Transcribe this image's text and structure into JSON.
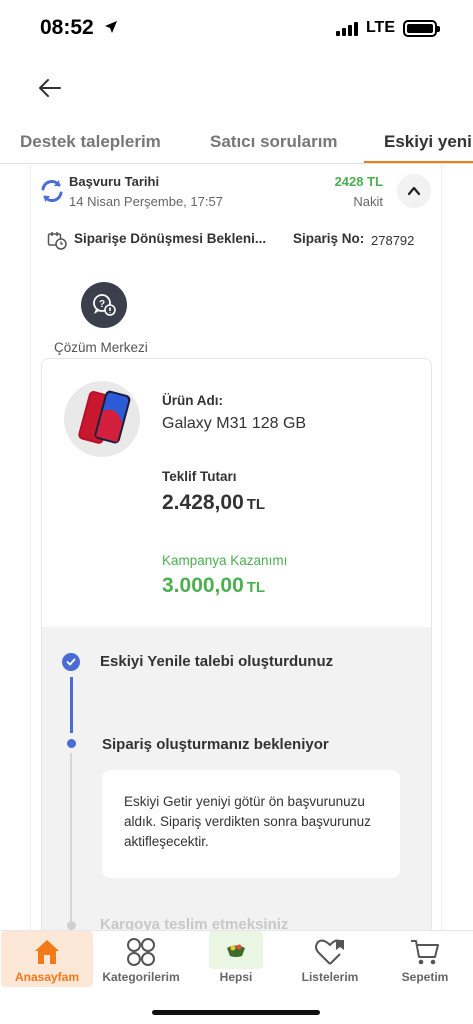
{
  "status_bar": {
    "time": "08:52",
    "network": "LTE"
  },
  "tabs": [
    {
      "label": "Destek taleplerim",
      "active": false
    },
    {
      "label": "Satıcı sorularım",
      "active": false
    },
    {
      "label": "Eskiyi yenil",
      "active": true
    }
  ],
  "application": {
    "date_label": "Başvuru Tarihi",
    "date_value": "14 Nisan Perşembe, 17:57",
    "amount": "2428 TL",
    "payment_type": "Nakit",
    "order_status": "Siparişe Dönüşmesi Bekleni...",
    "order_no_label": "Sipariş No:",
    "order_no": "278792"
  },
  "solution_center": {
    "label": "Çözüm Merkezi"
  },
  "product": {
    "name_label": "Ürün Adı:",
    "name": "Galaxy M31 128 GB",
    "offer_label": "Teklif Tutarı",
    "offer_value": "2.428,00",
    "offer_currency": "TL",
    "campaign_label": "Kampanya Kazanımı",
    "campaign_value": "3.000,00",
    "campaign_currency": "TL"
  },
  "timeline": {
    "step1": "Eskiyi Yenile talebi oluşturdunuz",
    "step2": "Sipariş oluşturmanız bekleniyor",
    "note": "Eskiyi Getir yeniyi götür ön başvurunuzu aldık. Sipariş verdikten sonra başvurunuz aktifleşecektir.",
    "step3": "Kargoya teslim etmeksiniz"
  },
  "bottom_nav": [
    {
      "label": "Anasayfam",
      "icon": "home-icon",
      "active": true
    },
    {
      "label": "Kategorilerim",
      "icon": "categories-icon",
      "active": false
    },
    {
      "label": "Hepsi",
      "icon": "hepsi-icon",
      "active": false
    },
    {
      "label": "Listelerim",
      "icon": "heart-list-icon",
      "active": false
    },
    {
      "label": "Sepetim",
      "icon": "cart-icon",
      "active": false
    }
  ],
  "colors": {
    "accent": "#f27a1a",
    "green": "#4caf50",
    "timeline_blue": "#4a6cd4"
  }
}
